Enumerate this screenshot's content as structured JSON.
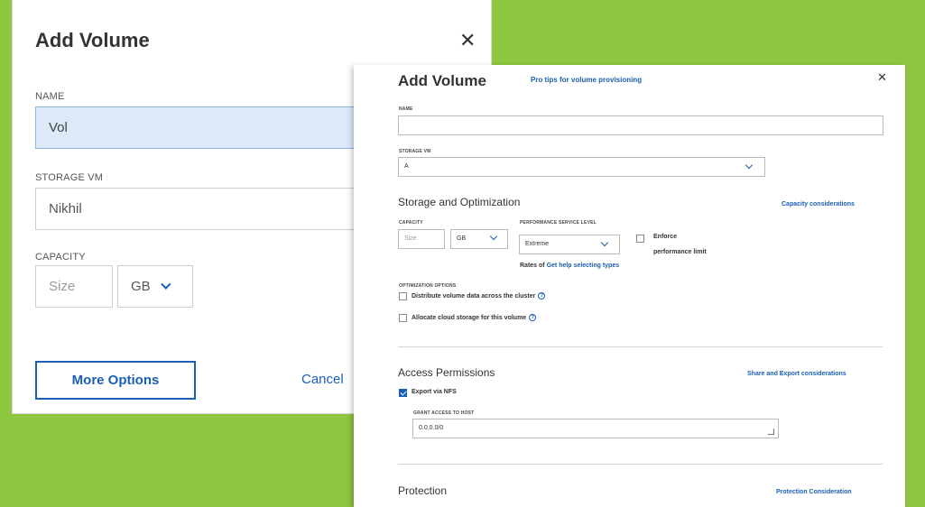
{
  "colors": {
    "background": "#8ec63f",
    "accent": "#1a5fb4",
    "focused_field": "#dbe9f8"
  },
  "simple_dialog": {
    "title": "Add Volume",
    "close_icon": "close-icon",
    "name_label": "NAME",
    "name_value": "Vol",
    "storage_vm_label": "STORAGE VM",
    "storage_vm_value": "Nikhil",
    "capacity_label": "CAPACITY",
    "capacity_placeholder": "Size",
    "capacity_unit": "GB",
    "more_options_label": "More Options",
    "cancel_label": "Cancel"
  },
  "advanced_dialog": {
    "title": "Add Volume",
    "tips_link": "Pro tips for volume provisioning",
    "close_icon": "close-icon",
    "name_label": "NAME",
    "name_value": "",
    "storage_vm_label": "STORAGE VM",
    "storage_vm_value": "A",
    "storage_section": {
      "heading": "Storage and Optimization",
      "link": "Capacity considerations",
      "capacity_label": "CAPACITY",
      "capacity_placeholder": "Size",
      "capacity_unit": "GB",
      "perf_label": "PERFORMANCE SERVICE LEVEL",
      "perf_value": "Extreme",
      "enforce_label_1": "Enforce",
      "enforce_label_2": "performance limit",
      "rates_prefix": "Rates of",
      "rates_link": "Get help selecting types",
      "opt_label": "OPTIMIZATION OPTIONS",
      "opt_distribute": "Distribute volume data across the cluster",
      "opt_cloud": "Allocate cloud storage for this volume"
    },
    "access_section": {
      "heading": "Access Permissions",
      "link": "Share and Export considerations",
      "export_label": "Export via NFS",
      "grant_label": "GRANT ACCESS TO HOST",
      "grant_value": "0.0.0.0/0"
    },
    "protection_section": {
      "heading": "Protection",
      "link": "Protection Consideration"
    }
  }
}
